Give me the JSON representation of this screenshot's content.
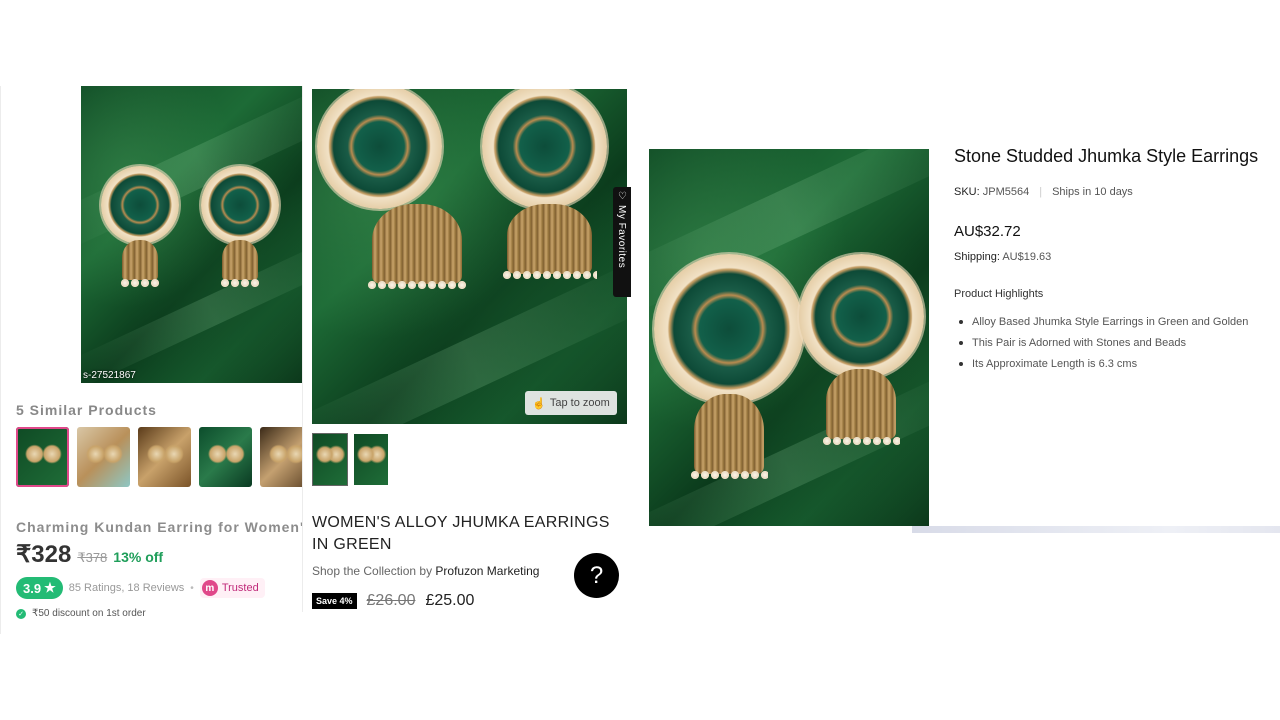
{
  "left_panel": {
    "sku_overlay": "s-27521867",
    "similar_title": "5 Similar Products",
    "product_name": "Charming Kundan Earring for Women's",
    "price": "₹328",
    "old_price": "₹378",
    "discount": "13% off",
    "rating": "3.9",
    "ratings_text": "85 Ratings, 18 Reviews",
    "trusted_label": "Trusted",
    "trusted_logo": "m",
    "first_order_discount": "₹50 discount on 1st order"
  },
  "middle_panel": {
    "favorites_label": "My Favorites",
    "zoom_label": "Tap to zoom",
    "title": "WOMEN'S ALLOY JHUMKA EARRINGS IN GREEN",
    "collection_prefix": "Shop the Collection by",
    "collection_brand": "Profuzon Marketing",
    "help_label": "?",
    "save_badge": "Save 4%",
    "old_price": "£26.00",
    "price": "£25.00"
  },
  "right_panel": {
    "title": "Stone Studded Jhumka Style Earrings",
    "sku_label": "SKU:",
    "sku_value": "JPM5564",
    "ships": "Ships in 10 days",
    "price": "AU$32.72",
    "shipping_label": "Shipping:",
    "shipping_value": "AU$19.63",
    "highlights_title": "Product Highlights",
    "highlights": [
      "Alloy Based Jhumka Style Earrings in Green and Golden",
      "This Pair is Adorned with Stones and Beads",
      "Its Approximate Length is 6.3 cms"
    ]
  },
  "colors": {
    "accent_pink": "#e0488a",
    "rating_green": "#23bb75",
    "discount_green": "#1f9e5a",
    "velvet_green": "#1d6b36"
  },
  "icons": [
    "star-icon",
    "check-icon",
    "heart-icon",
    "hand-zoom-icon",
    "help-icon"
  ]
}
